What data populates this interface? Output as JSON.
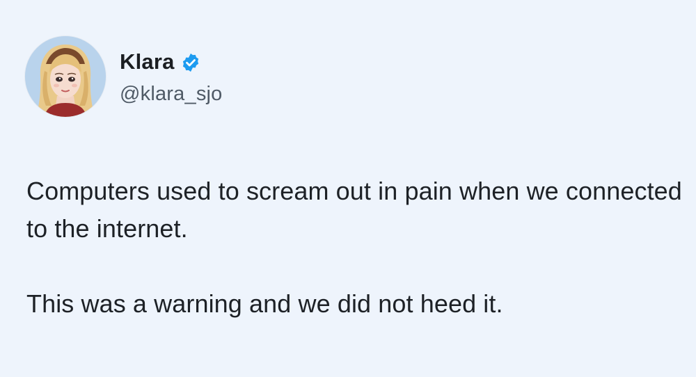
{
  "tweet": {
    "author": {
      "display_name": "Klara",
      "handle": "@klara_sjo",
      "verified": true,
      "avatar": "illustrated-blonde-woman-avatar"
    },
    "paragraphs": [
      "Computers used to scream out in pain when we connected to the internet.",
      "This was a warning and we did not heed it."
    ]
  },
  "colors": {
    "background": "#eef4fc",
    "verified_badge": "#1d9bf0",
    "text": "#1d2126",
    "secondary_text": "#4f5a66"
  }
}
